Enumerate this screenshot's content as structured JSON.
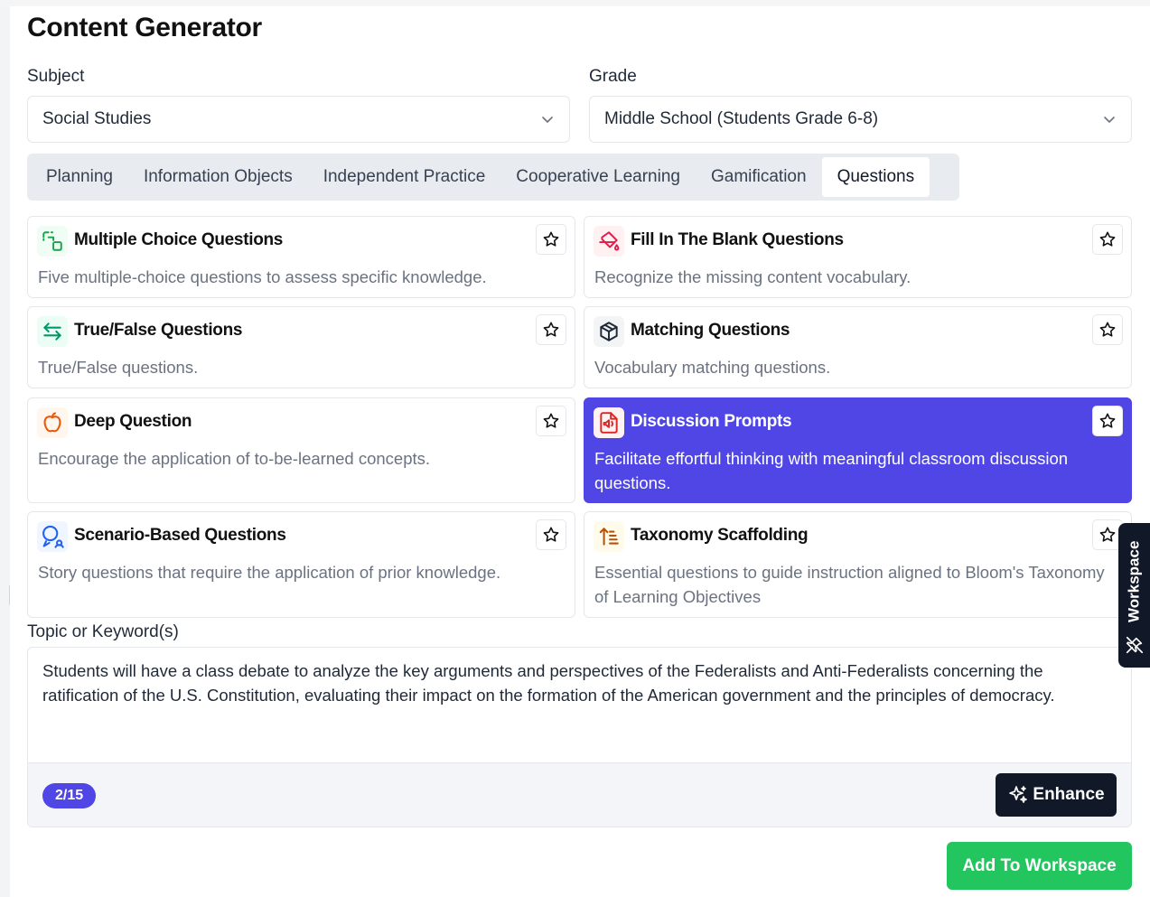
{
  "page_title": "Content Generator",
  "subject": {
    "label": "Subject",
    "value": "Social Studies"
  },
  "grade": {
    "label": "Grade",
    "value": "Middle School (Students Grade 6-8)"
  },
  "tabs": [
    {
      "label": "Planning",
      "active": false
    },
    {
      "label": "Information Objects",
      "active": false
    },
    {
      "label": "Independent Practice",
      "active": false
    },
    {
      "label": "Cooperative Learning",
      "active": false
    },
    {
      "label": "Gamification",
      "active": false
    },
    {
      "label": "Questions",
      "active": true
    }
  ],
  "cards": [
    {
      "title": "Multiple Choice Questions",
      "description": "Five multiple-choice questions to assess specific knowledge.",
      "icon": "shapes-icon",
      "icon_color": "#16a34a",
      "selected": false
    },
    {
      "title": "Fill In The Blank Questions",
      "description": "Recognize the missing content vocabulary.",
      "icon": "paint-bucket-icon",
      "icon_color": "#e11d48",
      "selected": false
    },
    {
      "title": "True/False Questions",
      "description": "True/False questions.",
      "icon": "swap-arrows-icon",
      "icon_color": "#059669",
      "selected": false
    },
    {
      "title": "Matching Questions",
      "description": "Vocabulary matching questions.",
      "icon": "box-icon",
      "icon_color": "#1f2937",
      "selected": false
    },
    {
      "title": "Deep Question",
      "description": "Encourage the application of to-be-learned concepts.",
      "icon": "apple-icon",
      "icon_color": "#ea580c",
      "selected": false
    },
    {
      "title": "Discussion Prompts",
      "description": "Facilitate effortful thinking with meaningful classroom discussion questions.",
      "icon": "file-audio-icon",
      "icon_color": "#dc2626",
      "selected": true
    },
    {
      "title": "Scenario-Based Questions",
      "description": "Story questions that require the application of prior knowledge.",
      "icon": "speech-person-icon",
      "icon_color": "#2563eb",
      "selected": false
    },
    {
      "title": "Taxonomy Scaffolding",
      "description": "Essential questions to guide instruction aligned to Bloom's Taxonomy of Learning Objectives",
      "icon": "sort-ascending-icon",
      "icon_color": "#b45309",
      "selected": false
    }
  ],
  "topic": {
    "label": "Topic or Keyword(s)",
    "value": "Students will have a class debate to analyze the key arguments and perspectives of the Federalists and Anti-Federalists concerning the ratification of the U.S. Constitution, evaluating their impact on the formation of the American government and the principles of democracy."
  },
  "counter": "2/15",
  "enhance_label": "Enhance",
  "add_label": "Add To Workspace",
  "workspace_label": "Workspace",
  "colors": {
    "accent": "#4f46e5",
    "add_button": "#22c55e",
    "dark": "#111827"
  }
}
